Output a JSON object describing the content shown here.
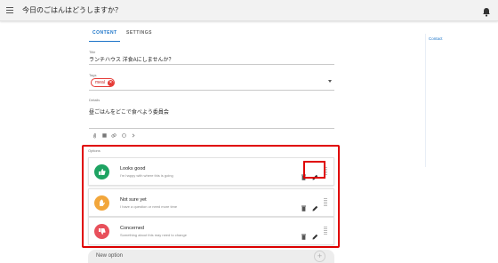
{
  "header": {
    "title": "今日のごはんはどうしますか？",
    "menu_icon": "hamburger-icon",
    "notification_icon": "bell-icon"
  },
  "tabs": [
    {
      "label": "CONTENT",
      "active": true
    },
    {
      "label": "SETTINGS",
      "active": false
    }
  ],
  "side": {
    "contact_label": "Contact"
  },
  "form": {
    "title": {
      "label": "Title",
      "value": "ランチハウス 洋食Aにしませんか？"
    },
    "tags": {
      "label": "Tags",
      "chips": [
        {
          "text": "meal"
        }
      ]
    },
    "details": {
      "label": "Details",
      "value": "昼ごはんをどこで食べよう委員会"
    },
    "toolbar_icons": [
      "paperclip-icon",
      "image-icon",
      "link-icon",
      "emoji-icon",
      "chevron-right-icon"
    ]
  },
  "options": {
    "label": "Options",
    "items": [
      {
        "title": "Looks good",
        "subtitle": "I'm happy with where this is going",
        "color": "#1ea362",
        "icon": "thumbs-up-icon"
      },
      {
        "title": "Not sure yet",
        "subtitle": "I have a question or need more time",
        "color": "#f2a63b",
        "icon": "hand-icon"
      },
      {
        "title": "Concerned",
        "subtitle": "Something about this may need to change",
        "color": "#e8505b",
        "icon": "thumbs-down-icon"
      }
    ],
    "new_option_placeholder": "New option"
  },
  "colors": {
    "accent": "#1a73c8",
    "highlight": "#e00000",
    "tag": "#e53935"
  }
}
